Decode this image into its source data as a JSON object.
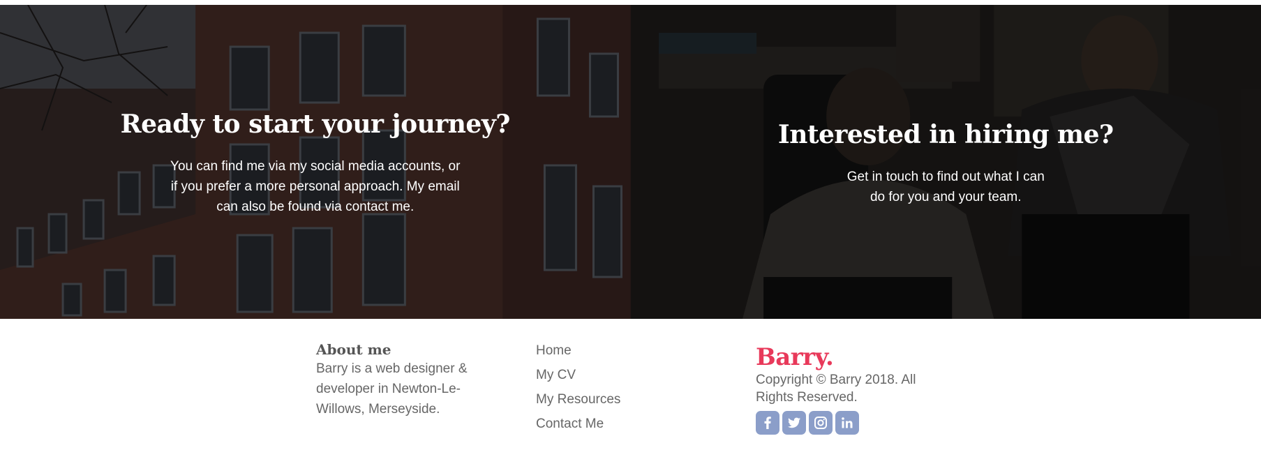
{
  "hero": {
    "left": {
      "title": "Ready to start your journey?",
      "text": "You can find me via my social media accounts, or if you prefer a more personal approach. My email can also be found via contact me."
    },
    "right": {
      "title": "Interested in hiring me?",
      "text": "Get in touch to find out what I can do for you and your team."
    }
  },
  "footer": {
    "about": {
      "title": "About me",
      "text": "Barry is a web designer & developer in Newton-Le-Willows, Merseyside."
    },
    "nav": [
      "Home",
      "My CV",
      "My Resources",
      "Contact Me"
    ],
    "brand": "Barry.",
    "copyright": "Copyright © Barry 2018. All Rights Reserved.",
    "social": [
      "facebook-icon",
      "twitter-icon",
      "instagram-icon",
      "linkedin-icon"
    ]
  },
  "colors": {
    "brand": "#e8395a",
    "social_icon_bg": "#8b9ec9",
    "footer_text": "#666666"
  }
}
